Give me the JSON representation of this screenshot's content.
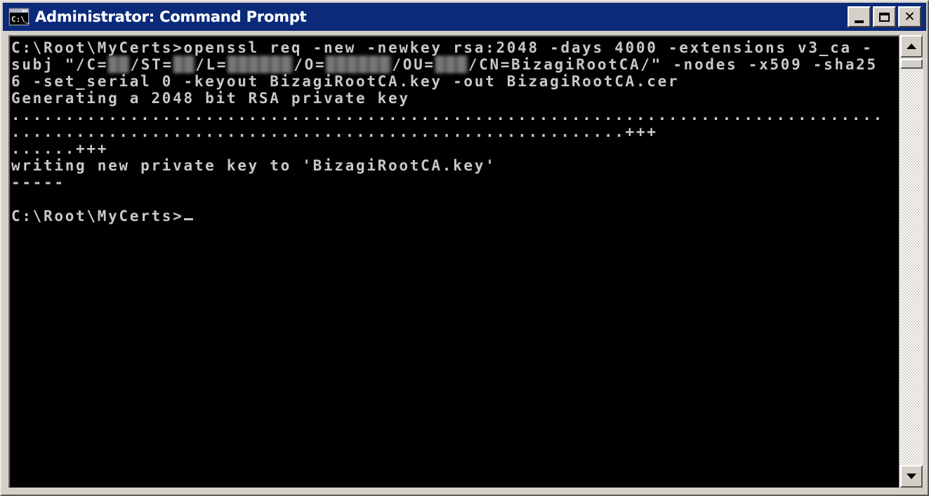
{
  "window": {
    "title": "Administrator: Command Prompt",
    "icon": "console-icon",
    "icon_label": "C:\\_",
    "colors": {
      "titlebar": "#0b2a7a",
      "frame": "#d4d0c8",
      "console_bg": "#000000",
      "console_fg": "#c8c8c8"
    },
    "controls": {
      "minimize": "minimize",
      "maximize": "maximize",
      "close": "close"
    }
  },
  "console": {
    "lines": [
      {
        "type": "text",
        "text": "C:\\Root\\MyCerts>openssl req -new -newkey rsa:2048 -days 4000 -extensions v3_ca -"
      },
      {
        "type": "mixed",
        "segments": [
          {
            "kind": "text",
            "text": "subj \"/C="
          },
          {
            "kind": "redacted",
            "width": 2
          },
          {
            "kind": "text",
            "text": "/ST="
          },
          {
            "kind": "redacted",
            "width": 2
          },
          {
            "kind": "text",
            "text": "/L="
          },
          {
            "kind": "redacted",
            "width": 6
          },
          {
            "kind": "text",
            "text": "/O="
          },
          {
            "kind": "redacted",
            "width": 6
          },
          {
            "kind": "text",
            "text": "/OU="
          },
          {
            "kind": "redacted",
            "width": 3
          },
          {
            "kind": "text",
            "text": "/CN=BizagiRootCA/\" -nodes -x509 -sha25"
          }
        ]
      },
      {
        "type": "text",
        "text": "6 -set_serial 0 -keyout BizagiRootCA.key -out BizagiRootCA.cer"
      },
      {
        "type": "text",
        "text": "Generating a 2048 bit RSA private key"
      },
      {
        "type": "dots",
        "count": 81,
        "suffix": ""
      },
      {
        "type": "dots",
        "count": 57,
        "suffix": "+++"
      },
      {
        "type": "dots",
        "count": 6,
        "suffix": "+++"
      },
      {
        "type": "text",
        "text": "writing new private key to 'BizagiRootCA.key'"
      },
      {
        "type": "text",
        "text": "-----"
      },
      {
        "type": "text",
        "text": ""
      },
      {
        "type": "prompt",
        "text": "C:\\Root\\MyCerts>"
      }
    ]
  },
  "scrollbar": {
    "up_arrow": "scroll-up-arrow",
    "down_arrow": "scroll-down-arrow",
    "thumb": "scroll-thumb"
  }
}
